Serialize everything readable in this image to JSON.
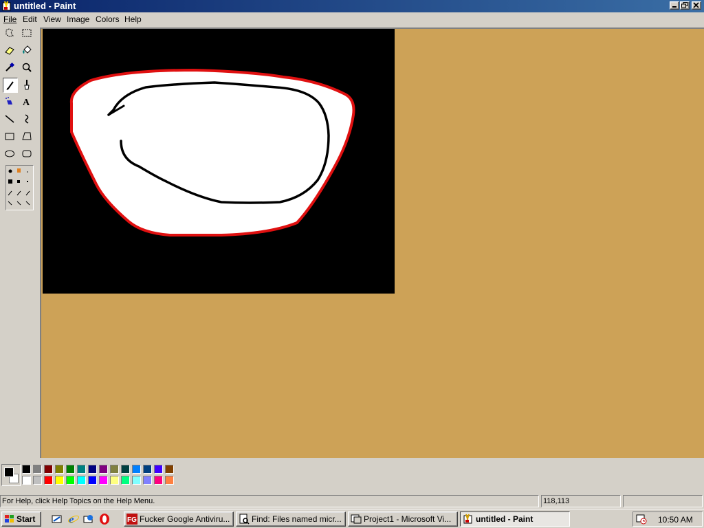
{
  "window": {
    "title": "untitled - Paint"
  },
  "menu": [
    {
      "key": "file",
      "label": "File"
    },
    {
      "key": "edit",
      "label": "Edit"
    },
    {
      "key": "view",
      "label": "View"
    },
    {
      "key": "image",
      "label": "Image"
    },
    {
      "key": "colors",
      "label": "Colors"
    },
    {
      "key": "help",
      "label": "Help"
    }
  ],
  "tools": [
    "free-form-select-icon",
    "select-icon",
    "eraser-icon",
    "fill-icon",
    "pick-color-icon",
    "magnifier-icon",
    "pencil-icon",
    "brush-icon",
    "airbrush-icon",
    "text-icon",
    "line-icon",
    "curve-icon",
    "rectangle-icon",
    "polygon-icon",
    "ellipse-icon",
    "rounded-rectangle-icon"
  ],
  "active_tool": "pencil",
  "canvas": {
    "background": "#000000",
    "shape_fill": "#ffffff",
    "shape_stroke": "#e01010",
    "inner_stroke": "#000000"
  },
  "workspace_color": "#cda257",
  "palette": {
    "foreground": "#000000",
    "background": "#ffffff",
    "row1": [
      "#000000",
      "#808080",
      "#800000",
      "#808000",
      "#008000",
      "#008080",
      "#000080",
      "#800080",
      "#808040",
      "#004040",
      "#0080ff",
      "#004080",
      "#4000ff",
      "#804000"
    ],
    "row2": [
      "#ffffff",
      "#c0c0c0",
      "#ff0000",
      "#ffff00",
      "#00ff00",
      "#00ffff",
      "#0000ff",
      "#ff00ff",
      "#ffff80",
      "#00ff80",
      "#80ffff",
      "#8080ff",
      "#ff0080",
      "#ff8040"
    ]
  },
  "status": {
    "help_text": "For Help, click Help Topics on the Help Menu.",
    "coords": "118,113",
    "size": ""
  },
  "taskbar": {
    "start_label": "Start",
    "tasks": [
      {
        "label": "Fucker Google Antiviru...",
        "icon": "fg-icon"
      },
      {
        "label": "Find: Files named micr...",
        "icon": "find-icon"
      },
      {
        "label": "Project1 - Microsoft Vi...",
        "icon": "vb-icon"
      },
      {
        "label": "untitled - Paint",
        "icon": "paint-icon"
      }
    ],
    "clock": "10:50 AM"
  }
}
